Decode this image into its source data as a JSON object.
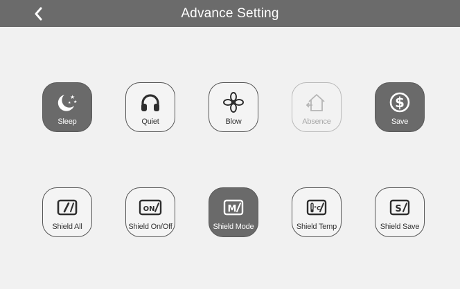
{
  "header": {
    "title": "Advance Setting"
  },
  "row1": [
    {
      "label": "Sleep",
      "icon": "moon-stars-icon",
      "state": "active"
    },
    {
      "label": "Quiet",
      "icon": "headphones-icon",
      "state": "normal"
    },
    {
      "label": "Blow",
      "icon": "fan-blow-icon",
      "state": "normal"
    },
    {
      "label": "Absence",
      "icon": "home-absence-icon",
      "state": "disabled"
    },
    {
      "label": "Save",
      "icon": "dollar-save-icon",
      "state": "active"
    }
  ],
  "row2": [
    {
      "label": "Shield All",
      "icon": "shield-all-icon",
      "glyph": "/",
      "state": "normal"
    },
    {
      "label": "Shield On/Off",
      "icon": "shield-onoff-icon",
      "glyph": "ON/",
      "state": "normal"
    },
    {
      "label": "Shield Mode",
      "icon": "shield-mode-icon",
      "glyph": "M/",
      "state": "active"
    },
    {
      "label": "Shield Temp",
      "icon": "shield-temp-icon",
      "glyph": "°C/",
      "state": "normal"
    },
    {
      "label": "Shield Save",
      "icon": "shield-save-icon",
      "glyph": "S/",
      "state": "normal"
    }
  ],
  "colors": {
    "header_bg": "#6b6b6b",
    "active_tile_bg": "#6a6a6a",
    "page_bg": "#f1f1f1",
    "disabled": "#b9b9b9"
  }
}
